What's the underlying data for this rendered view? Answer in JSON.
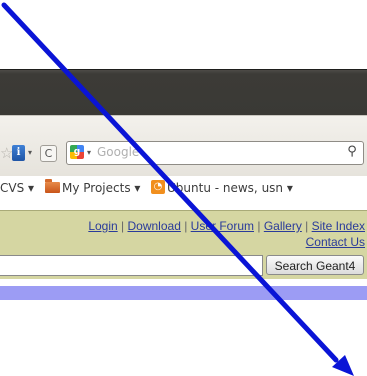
{
  "browser": {
    "search_placeholder": "Google",
    "bookmarks": [
      {
        "label": "CVS",
        "dropdown": "▾"
      },
      {
        "label": "My Projects",
        "dropdown": "▾"
      },
      {
        "label": "Ubuntu - news, usn",
        "dropdown": "▾"
      }
    ],
    "icons": {
      "star": "☆",
      "identity": "i",
      "dropdown": "▾",
      "reload": "C",
      "search_engine": "g",
      "magnifier": "⚲",
      "rss": ")"
    }
  },
  "page": {
    "links": {
      "login": "Login",
      "download": "Download",
      "user_forum": "User Forum",
      "gallery": "Gallery",
      "site_index": "Site Index",
      "contact_us": "Contact Us",
      "separator": " | "
    },
    "search_button": "Search Geant4"
  },
  "overlay": {
    "arrow_color": "#0a14d6"
  },
  "colors": {
    "header_band": "#d5d6a2",
    "purple_bar": "#9c9cf4",
    "link": "#2a3b9a",
    "titlebar": "#3c3b37"
  }
}
